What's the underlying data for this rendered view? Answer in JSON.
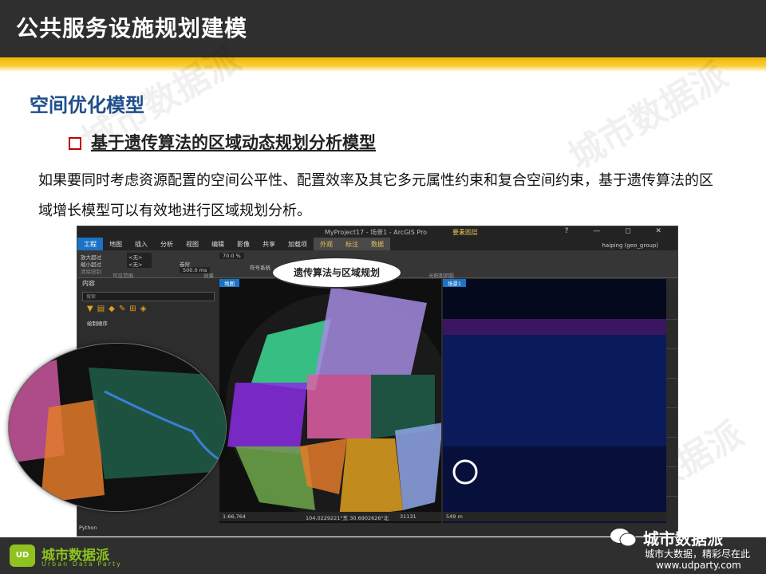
{
  "slide": {
    "header_title": "公共服务设施规划建模",
    "section_title": "空间优化模型",
    "subhead": "基于遗传算法的区域动态规划分析模型",
    "paragraph": "如果要同时考虑资源配置的空间公平性、配置效率及其它多元属性约束和复合空间约束，基于遗传算法的区域增长模型可以有效地进行区域规划分析。",
    "callout": "遗传算法与区域规划",
    "watermark": "城市数据派",
    "watermark_url": "www.udparty.com"
  },
  "app": {
    "title": "MyProject17 - 场景1 - ArcGIS Pro",
    "context_group": "要素图层",
    "tabs": [
      "工程",
      "地图",
      "插入",
      "分析",
      "视图",
      "编辑",
      "影像",
      "共享",
      "加载项",
      "外观",
      "标注",
      "数据"
    ],
    "user": "haiping (geo_group)",
    "ribbon": {
      "zoom_in_label": "放大超过",
      "zoom_out_label": "缩小超过",
      "none_1": "<无>",
      "none_2": "<无>",
      "clear_limits": "清除限制",
      "visible_range_group": "可见范围",
      "transparency": "70.0 %",
      "swipe": "卷帘",
      "flicker": "500.0 ms",
      "effects_group": "效果",
      "symbology": "符号系统",
      "lighting_group": "光照和阴影"
    },
    "contents": {
      "title": "内容",
      "search_placeholder": "搜索",
      "draw_order": "绘制顺序"
    },
    "map_tab": "地图",
    "scene_tab": "场景1",
    "status_map": {
      "scale": "1:66,764",
      "coords": "104.0229221°东 30.6902626°北",
      "count": "31131"
    },
    "status_scene": {
      "distance": "549 m"
    },
    "python": "Python"
  },
  "footer": {
    "logo_cn": "城市数据派",
    "logo_en": "Urban Data Party",
    "wechat_name": "城市数据派",
    "wechat_sub": "城市大数据，精彩尽在此",
    "site": "www.udparty.com"
  },
  "colors": {
    "accent_blue": "#1f4e8a",
    "stripe": "#f3b400",
    "brand_green": "#8dc21f",
    "checkbox_red": "#c00000"
  }
}
